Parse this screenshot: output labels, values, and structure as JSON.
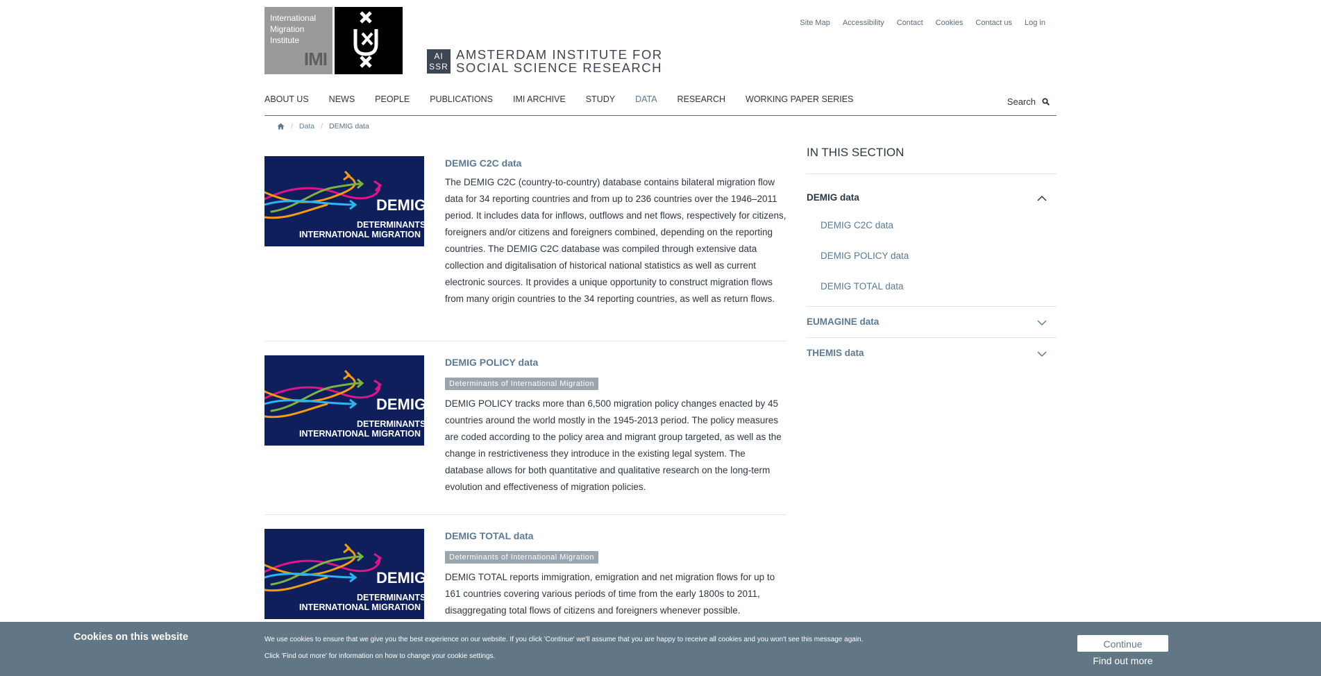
{
  "header": {
    "imi_logo_lines": [
      "International",
      "Migration",
      "Institute"
    ],
    "imi_logo_mark": "IMI",
    "aissr_box_lines": [
      "AI",
      "SSR"
    ],
    "aissr_text_lines": [
      "AMSTERDAM INSTITUTE FOR",
      "SOCIAL SCIENCE RESEARCH"
    ],
    "util_nav": [
      "Site Map",
      "Accessibility",
      "Contact",
      "Cookies",
      "Contact us",
      "Log in"
    ]
  },
  "main_nav": {
    "items": [
      "ABOUT US",
      "NEWS",
      "PEOPLE",
      "PUBLICATIONS",
      "IMI ARCHIVE",
      "STUDY",
      "DATA",
      "RESEARCH",
      "WORKING PAPER SERIES"
    ],
    "active": "DATA",
    "search_label": "Search"
  },
  "breadcrumb": {
    "items": [
      "Data",
      "DEMIG data"
    ]
  },
  "thumbnail": {
    "line1": "DEMIG",
    "line2": "DETERMINANTS OF",
    "line3": "INTERNATIONAL MIGRATION"
  },
  "items": [
    {
      "title": "DEMIG C2C data",
      "tag": "",
      "description": "The DEMIG C2C (country-to-country) database contains bilateral migration flow data for 34 reporting countries and from up to 236 countries over the 1946–2011 period. It includes data for inflows, outflows and net flows, respectively for citizens, foreigners and/or citizens and foreigners combined, depending on the reporting countries. The DEMIG C2C database was compiled through extensive data collection and digitalisation of historical national statistics as well as current electronic sources. It provides a unique opportunity to construct migration flows from many origin countries to the 34 reporting countries, as well as return flows."
    },
    {
      "title": "DEMIG POLICY data",
      "tag": "Determinants of International Migration",
      "description": "DEMIG POLICY tracks more than 6,500 migration policy changes enacted by 45 countries around the world mostly in the 1945-2013 period. The policy measures are coded according to the policy area and migrant group targeted, as well as the change in restrictiveness they introduce in the existing legal system. The database allows for both quantitative and qualitative research on the long-term evolution and effectiveness of migration policies."
    },
    {
      "title": "DEMIG TOTAL data",
      "tag": "Determinants of International Migration",
      "description": "DEMIG TOTAL reports immigration, emigration and net migration flows for up to 161 countries covering various periods of time from the early 1800s to 2011, disaggregating total flows of citizens and foreigners whenever possible."
    }
  ],
  "sidebar": {
    "heading": "IN THIS SECTION",
    "groups": [
      {
        "title": "DEMIG data",
        "expanded": true,
        "children": [
          "DEMIG C2C data",
          "DEMIG POLICY data",
          "DEMIG TOTAL data"
        ]
      },
      {
        "title": "EUMAGINE data",
        "expanded": false
      },
      {
        "title": "THEMIS data",
        "expanded": false
      }
    ]
  },
  "cookie_bar": {
    "title": "Cookies on this website",
    "text_line1": "We use cookies to ensure that we give you the best experience on our website. If you click 'Continue' we'll assume that you are happy to receive all cookies and you won't see this message again.",
    "text_line2": "Click 'Find out more' for information on how to change your cookie settings.",
    "continue_label": "Continue",
    "find_out_more_label": "Find out more"
  },
  "colors": {
    "navy": "#0f1f5c",
    "accent": "#5b7a95",
    "cookie_bg": "#617786"
  }
}
